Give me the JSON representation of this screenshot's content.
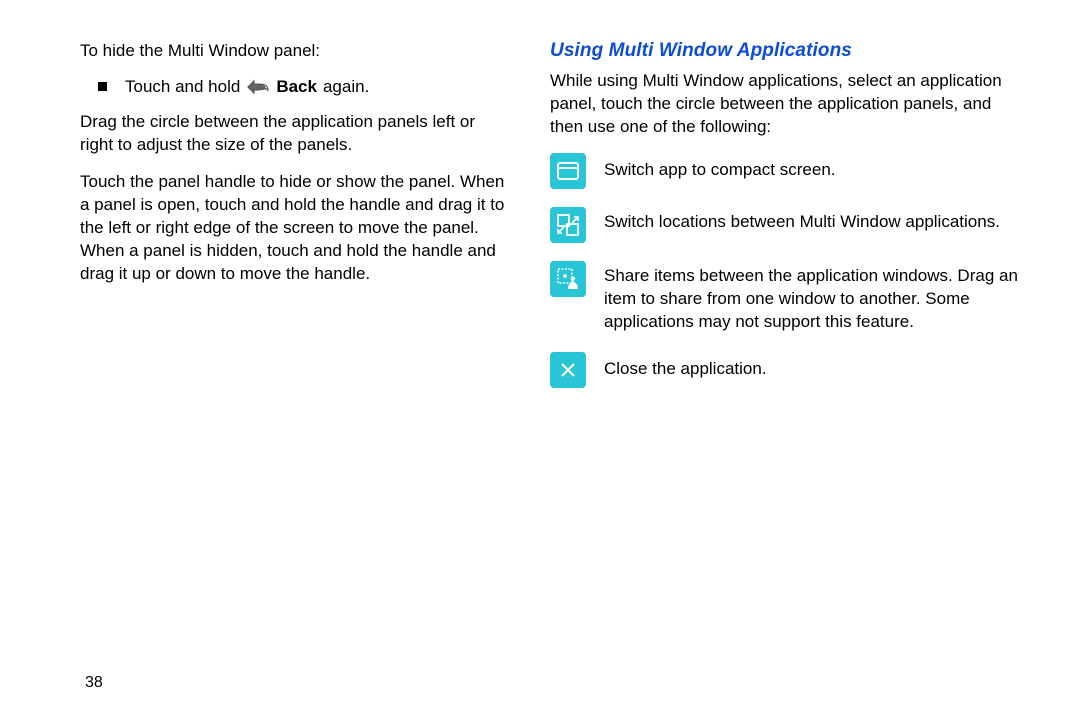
{
  "left": {
    "intro": "To hide the Multi Window panel:",
    "bullet_prefix": "Touch and hold",
    "bullet_bold": "Back",
    "bullet_suffix": " again.",
    "p2": "Drag the circle between the application panels left or right to adjust the size of the panels.",
    "p3": "Touch the panel handle to hide or show the panel. When a panel is open, touch and hold the handle and drag it to the left or right edge of the screen to move the panel. When a panel is hidden, touch and hold the handle and drag it up or down to move the handle."
  },
  "right": {
    "title": "Using Multi Window Applications",
    "intro": "While using Multi Window applications, select an application panel, touch the circle between the application panels, and then use one of the following:",
    "items": [
      {
        "icon": "compact-icon",
        "text": "Switch app to compact screen."
      },
      {
        "icon": "swap-icon",
        "text": "Switch locations between Multi Window applications."
      },
      {
        "icon": "share-icon",
        "text": "Share items between the application windows. Drag an item to share from one window to another. Some applications may not support this feature."
      },
      {
        "icon": "close-icon",
        "text": "Close the application."
      }
    ]
  },
  "page_number": "38"
}
